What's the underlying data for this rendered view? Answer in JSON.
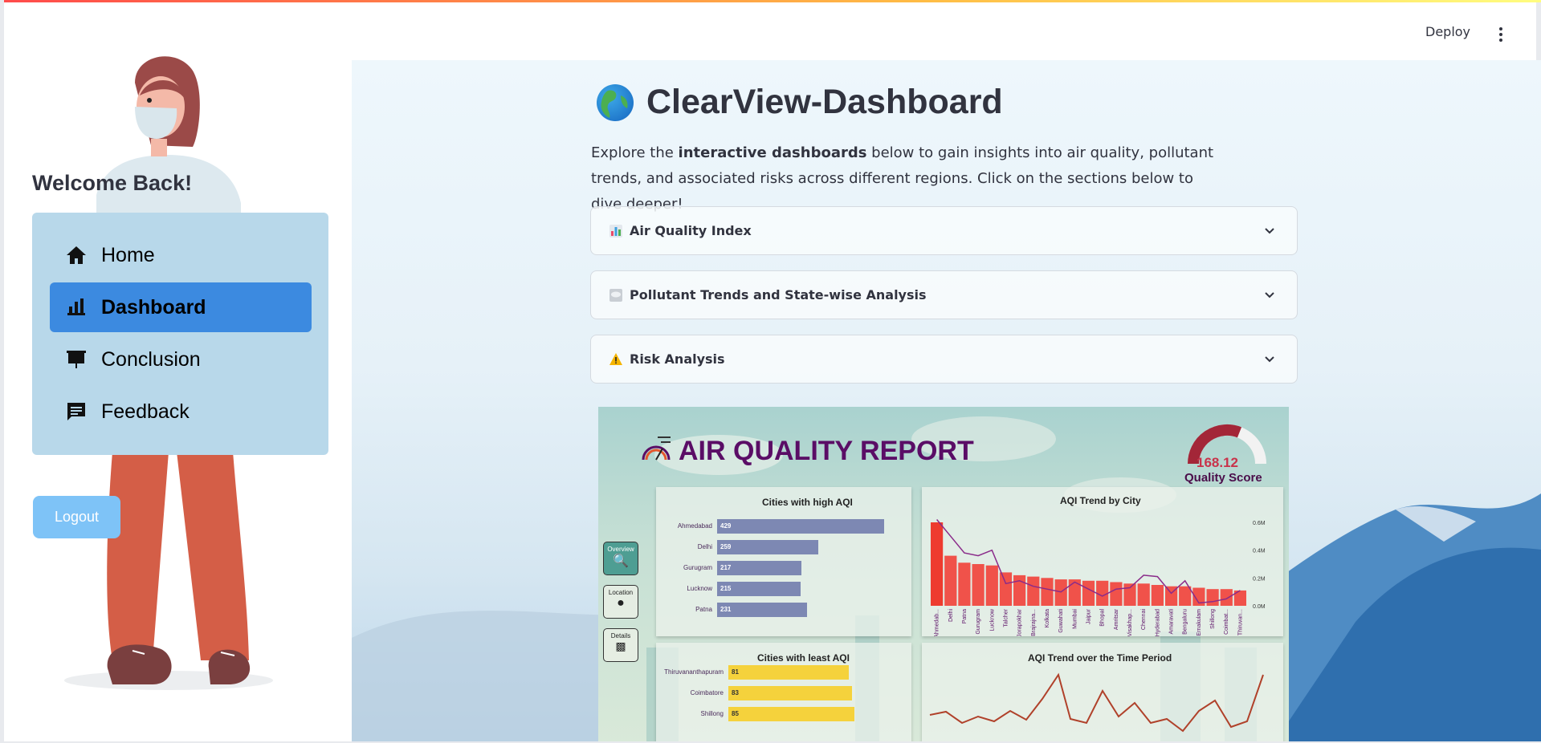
{
  "header": {
    "deploy_label": "Deploy"
  },
  "sidebar": {
    "welcome": "Welcome Back!",
    "menu": [
      {
        "label": "Home",
        "icon": "house-icon"
      },
      {
        "label": "Dashboard",
        "icon": "bar-chart-icon",
        "active": true
      },
      {
        "label": "Conclusion",
        "icon": "presentation-icon"
      },
      {
        "label": "Feedback",
        "icon": "chat-icon"
      }
    ],
    "logout_label": "Logout"
  },
  "main": {
    "title": "ClearView-Dashboard",
    "intro_pre": "Explore the ",
    "intro_bold": "interactive dashboards",
    "intro_post": " below to gain insights into air quality, pollutant trends, and associated risks across different regions. Click on the sections below to dive deeper!",
    "expanders": [
      {
        "label": "Air Quality Index",
        "icon": "bar-chart-icon"
      },
      {
        "label": "Pollutant Trends and State-wise Analysis",
        "icon": "cloud-icon"
      },
      {
        "label": "Risk Analysis",
        "icon": "warning-icon"
      }
    ]
  },
  "report": {
    "title": "AIR QUALITY REPORT",
    "score": "168.12",
    "score_label": "Quality Score",
    "score_fraction": 0.62,
    "nav": [
      "Overview",
      "Location",
      "Details"
    ],
    "high_aqi_title": "Cities with high AQI",
    "trend_city_title": "AQI Trend by City",
    "least_aqi_title": "Cities with least AQI",
    "trend_time_title": "AQI Trend over the Time Period",
    "accent_purple": "#5a0d66",
    "bar_red": "#f0524a"
  },
  "chart_data": [
    {
      "type": "bar",
      "title": "Cities with high AQI",
      "categories": [
        "Ahmedabad",
        "Delhi",
        "Gurugram",
        "Lucknow",
        "Patna"
      ],
      "values": [
        429,
        259,
        217,
        215,
        231
      ]
    },
    {
      "type": "bar",
      "title": "AQI Trend by City",
      "categories": [
        "Ahmedab...",
        "Delhi",
        "Patna",
        "Gurugram",
        "Lucknow",
        "Talcher",
        "Jorapokhar",
        "Brajrajna...",
        "Kolkata",
        "Guwahati",
        "Mumbai",
        "Jaipur",
        "Bhopal",
        "Amritsar",
        "Visakhap...",
        "Chennai",
        "Hyderabad",
        "Amaravati",
        "Bengaluru",
        "Ernakulam",
        "Shillong",
        "Coimbat...",
        "Thiruvan..."
      ],
      "yticks": [
        "0.0M",
        "0.2M",
        "0.4M",
        "0.6M"
      ],
      "ylim": [
        0,
        0.6
      ],
      "values": [
        0.6,
        0.36,
        0.31,
        0.3,
        0.29,
        0.24,
        0.22,
        0.21,
        0.2,
        0.19,
        0.19,
        0.18,
        0.18,
        0.17,
        0.16,
        0.16,
        0.15,
        0.14,
        0.14,
        0.13,
        0.12,
        0.12,
        0.11
      ],
      "line": [
        0.62,
        0.5,
        0.38,
        0.36,
        0.4,
        0.16,
        0.18,
        0.14,
        0.12,
        0.1,
        0.17,
        0.12,
        0.07,
        0.12,
        0.13,
        0.22,
        0.21,
        0.09,
        0.18,
        0.02,
        0.03,
        0.05,
        0.11
      ]
    },
    {
      "type": "bar",
      "title": "Cities with least AQI",
      "categories": [
        "Thiruvananthapuram",
        "Coimbatore",
        "Shillong"
      ],
      "values": [
        81,
        83,
        85
      ]
    }
  ]
}
